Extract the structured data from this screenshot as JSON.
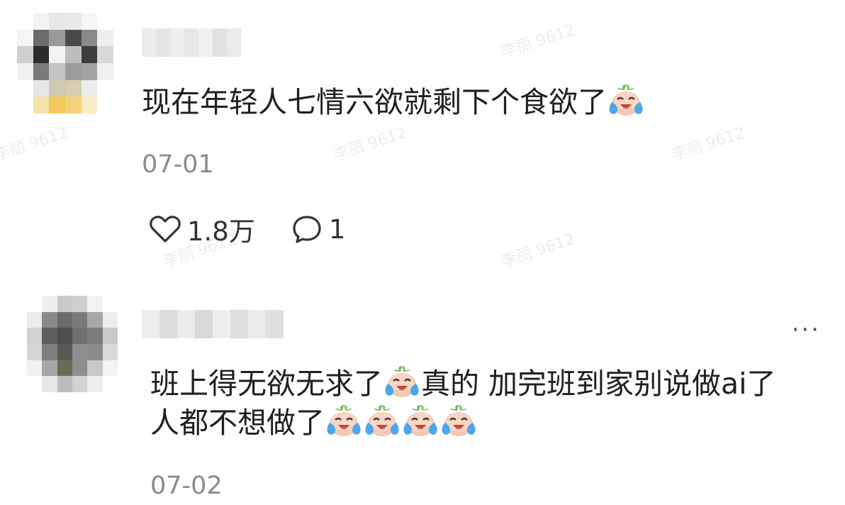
{
  "watermark": "李丽 9612",
  "comments": [
    {
      "text": "现在年轻人七情六欲就剩下个食欲了",
      "date": "07-01",
      "like_icon": "heart-outline-icon",
      "like_count": "1.8万",
      "reply_icon": "speech-bubble-icon",
      "reply_count": "1"
    },
    {
      "text_part1": "班上得无欲无求了",
      "text_part2": "真的 加完班到家别说做ai了",
      "text_line2": "人都不想做了",
      "more_label": "···",
      "date": "07-02"
    }
  ],
  "emoji_name": "crying-laughing-sticker-emoji",
  "colors": {
    "text": "#1f1f1f",
    "date": "#8b8b8b",
    "background": "#ffffff"
  }
}
